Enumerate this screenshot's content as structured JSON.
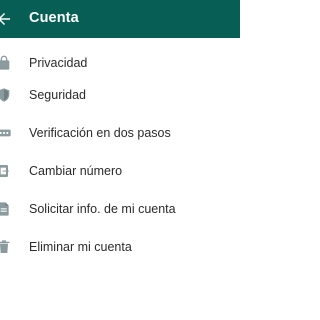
{
  "colors": {
    "appbar": "#075e54",
    "icon": "#8a9a9d",
    "text": "#2b2b2b"
  },
  "header": {
    "title": "Cuenta",
    "back_icon": "arrow-left-icon"
  },
  "menu": [
    {
      "label": "Privacidad",
      "icon": "lock-icon"
    },
    {
      "label": "Seguridad",
      "icon": "shield-icon"
    },
    {
      "label": "Verificación en dos pasos",
      "icon": "dots-icon"
    },
    {
      "label": "Cambiar número",
      "icon": "phone-swap-icon"
    },
    {
      "label": "Solicitar info. de mi cuenta",
      "icon": "document-icon"
    },
    {
      "label": "Eliminar mi cuenta",
      "icon": "trash-icon"
    }
  ]
}
